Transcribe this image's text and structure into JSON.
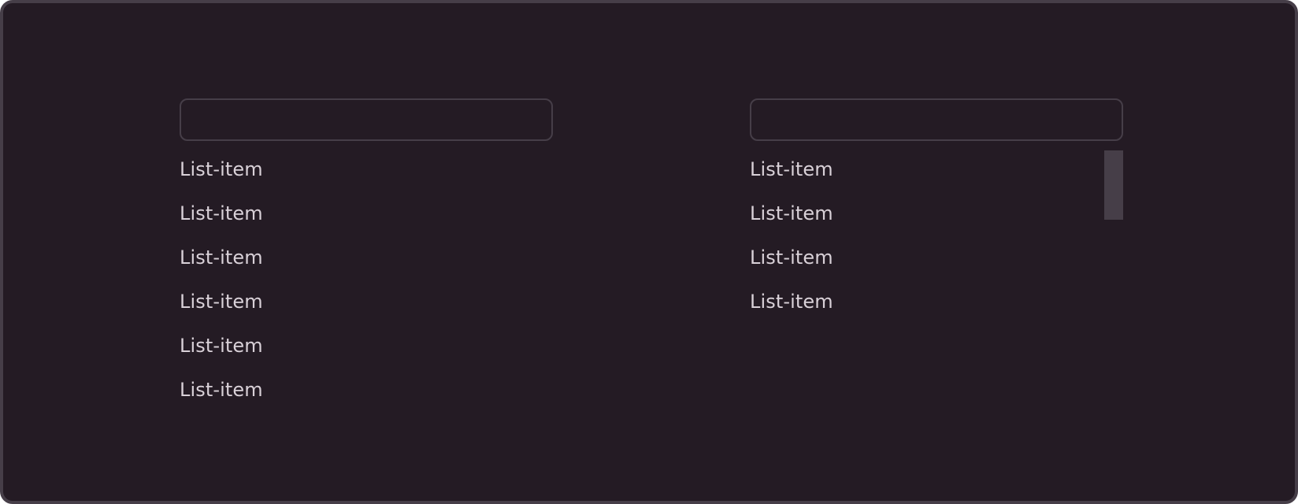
{
  "left_panel": {
    "search": {
      "value": "",
      "placeholder": ""
    },
    "items": [
      "List-item",
      "List-item",
      "List-item",
      "List-item",
      "List-item",
      "List-item"
    ]
  },
  "right_panel": {
    "search": {
      "value": "",
      "placeholder": ""
    },
    "items": [
      "List-item",
      "List-item",
      "List-item",
      "List-item"
    ],
    "scrollbar": {
      "color": "#463e48"
    }
  },
  "colors": {
    "background": "#241b24",
    "border": "#463e48",
    "text": "#d9d1d8"
  }
}
